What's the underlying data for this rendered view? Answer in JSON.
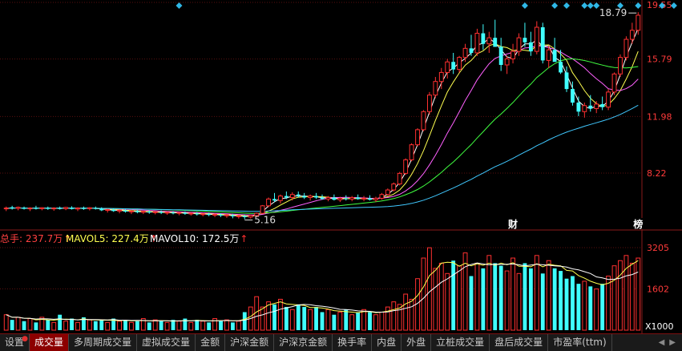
{
  "chart_data": [
    {
      "type": "candlestick",
      "price_axis": {
        "ticks": [
          "19.55",
          "15.79",
          "11.98",
          "8.22"
        ]
      },
      "annotations": {
        "high_label": "18.79",
        "low_label": "5.16",
        "markers": [
          "财",
          "榜"
        ]
      },
      "moving_averages": [
        {
          "color": "#ffffff"
        },
        {
          "color": "#ffff50"
        },
        {
          "color": "#ff60ff"
        },
        {
          "color": "#40ff40"
        },
        {
          "color": "#40c8ff"
        }
      ],
      "colors": {
        "up": "#ff3030",
        "down": "#40ffff",
        "diamond": "#2fb7e6"
      },
      "candles": [
        [
          5.9,
          6.0,
          5.7,
          5.9
        ],
        [
          5.95,
          6.05,
          5.8,
          5.88
        ],
        [
          5.88,
          6.0,
          5.75,
          5.95
        ],
        [
          5.92,
          6.0,
          5.8,
          5.85
        ],
        [
          5.85,
          5.95,
          5.7,
          5.9
        ],
        [
          5.9,
          6.05,
          5.8,
          5.88
        ],
        [
          5.86,
          5.95,
          5.75,
          5.92
        ],
        [
          5.9,
          6.0,
          5.78,
          5.85
        ],
        [
          5.85,
          5.95,
          5.72,
          5.9
        ],
        [
          5.9,
          6.0,
          5.8,
          5.86
        ],
        [
          5.86,
          5.98,
          5.76,
          5.94
        ],
        [
          5.92,
          6.02,
          5.8,
          5.84
        ],
        [
          5.84,
          5.95,
          5.7,
          5.9
        ],
        [
          5.9,
          6.0,
          5.78,
          5.86
        ],
        [
          5.86,
          5.96,
          5.74,
          5.92
        ],
        [
          5.9,
          6.0,
          5.8,
          5.85
        ],
        [
          5.85,
          5.95,
          5.7,
          5.75
        ],
        [
          5.75,
          5.85,
          5.6,
          5.8
        ],
        [
          5.78,
          5.88,
          5.65,
          5.7
        ],
        [
          5.7,
          5.8,
          5.55,
          5.76
        ],
        [
          5.74,
          5.84,
          5.6,
          5.66
        ],
        [
          5.66,
          5.76,
          5.5,
          5.7
        ],
        [
          5.7,
          5.8,
          5.55,
          5.62
        ],
        [
          5.62,
          5.72,
          5.5,
          5.68
        ],
        [
          5.66,
          5.76,
          5.52,
          5.6
        ],
        [
          5.6,
          5.7,
          5.48,
          5.65
        ],
        [
          5.64,
          5.74,
          5.5,
          5.58
        ],
        [
          5.58,
          5.68,
          5.45,
          5.62
        ],
        [
          5.6,
          5.7,
          5.48,
          5.55
        ],
        [
          5.55,
          5.65,
          5.42,
          5.6
        ],
        [
          5.58,
          5.68,
          5.45,
          5.52
        ],
        [
          5.52,
          5.62,
          5.4,
          5.56
        ],
        [
          5.54,
          5.64,
          5.4,
          5.48
        ],
        [
          5.48,
          5.58,
          5.35,
          5.52
        ],
        [
          5.5,
          5.6,
          5.36,
          5.44
        ],
        [
          5.44,
          5.54,
          5.3,
          5.48
        ],
        [
          5.46,
          5.56,
          5.3,
          5.4
        ],
        [
          5.4,
          5.5,
          5.25,
          5.44
        ],
        [
          5.42,
          5.52,
          5.22,
          5.35
        ],
        [
          5.35,
          5.45,
          5.2,
          5.38
        ],
        [
          5.36,
          5.46,
          5.16,
          5.3
        ],
        [
          5.3,
          5.45,
          5.2,
          5.4
        ],
        [
          5.4,
          5.6,
          5.3,
          5.55
        ],
        [
          5.55,
          6.1,
          5.5,
          6.05
        ],
        [
          6.05,
          6.6,
          5.95,
          6.5
        ],
        [
          6.5,
          6.9,
          6.3,
          6.4
        ],
        [
          6.4,
          6.8,
          6.2,
          6.7
        ],
        [
          6.7,
          7.0,
          6.5,
          6.6
        ],
        [
          6.6,
          6.95,
          6.4,
          6.8
        ],
        [
          6.8,
          7.0,
          6.6,
          6.7
        ],
        [
          6.7,
          6.9,
          6.5,
          6.6
        ],
        [
          6.6,
          6.8,
          6.4,
          6.7
        ],
        [
          6.7,
          6.9,
          6.5,
          6.6
        ],
        [
          6.6,
          6.8,
          6.45,
          6.5
        ],
        [
          6.5,
          6.7,
          6.35,
          6.6
        ],
        [
          6.6,
          6.8,
          6.4,
          6.45
        ],
        [
          6.45,
          6.65,
          6.3,
          6.55
        ],
        [
          6.55,
          6.75,
          6.4,
          6.5
        ],
        [
          6.5,
          6.7,
          6.35,
          6.6
        ],
        [
          6.6,
          6.8,
          6.45,
          6.5
        ],
        [
          6.5,
          6.7,
          6.35,
          6.55
        ],
        [
          6.55,
          6.75,
          6.4,
          6.45
        ],
        [
          6.45,
          6.65,
          6.3,
          6.55
        ],
        [
          6.55,
          6.9,
          6.45,
          6.8
        ],
        [
          6.8,
          7.2,
          6.7,
          7.1
        ],
        [
          7.1,
          7.6,
          7.0,
          7.5
        ],
        [
          7.5,
          8.3,
          7.4,
          8.2
        ],
        [
          8.2,
          9.2,
          8.1,
          9.1
        ],
        [
          9.1,
          10.2,
          9.0,
          10.1
        ],
        [
          10.1,
          11.2,
          10.0,
          11.1
        ],
        [
          11.1,
          12.4,
          11.0,
          12.3
        ],
        [
          12.3,
          13.6,
          12.1,
          13.4
        ],
        [
          13.4,
          14.6,
          13.2,
          14.3
        ],
        [
          14.3,
          15.2,
          13.8,
          14.9
        ],
        [
          14.9,
          15.8,
          14.5,
          15.6
        ],
        [
          15.6,
          16.2,
          14.8,
          15.1
        ],
        [
          15.1,
          16.0,
          14.9,
          15.9
        ],
        [
          15.9,
          16.8,
          15.6,
          16.5
        ],
        [
          16.5,
          17.4,
          16.0,
          16.2
        ],
        [
          16.2,
          17.8,
          16.0,
          17.5
        ],
        [
          17.5,
          18.1,
          16.4,
          16.8
        ],
        [
          16.8,
          17.6,
          16.2,
          17.2
        ],
        [
          17.2,
          18.4,
          16.8,
          16.6
        ],
        [
          16.6,
          17.2,
          15.0,
          15.4
        ],
        [
          15.4,
          16.0,
          14.8,
          15.8
        ],
        [
          15.8,
          16.8,
          15.5,
          16.3
        ],
        [
          16.3,
          17.5,
          16.0,
          17.2
        ],
        [
          17.2,
          18.2,
          16.6,
          16.9
        ],
        [
          16.9,
          17.6,
          16.0,
          16.3
        ],
        [
          16.3,
          18.3,
          16.1,
          17.9
        ],
        [
          17.9,
          18.2,
          15.5,
          15.7
        ],
        [
          15.7,
          16.7,
          15.2,
          16.4
        ],
        [
          16.4,
          17.2,
          15.8,
          15.6
        ],
        [
          15.6,
          16.4,
          14.8,
          14.9
        ],
        [
          14.9,
          15.3,
          13.6,
          13.8
        ],
        [
          13.8,
          14.3,
          12.7,
          12.9
        ],
        [
          12.9,
          13.3,
          12.0,
          12.3
        ],
        [
          12.3,
          12.9,
          11.9,
          12.7
        ],
        [
          12.7,
          13.4,
          12.3,
          12.5
        ],
        [
          12.5,
          13.0,
          12.2,
          12.8
        ],
        [
          12.8,
          13.3,
          12.4,
          12.6
        ],
        [
          12.6,
          13.8,
          12.4,
          13.6
        ],
        [
          13.6,
          14.9,
          13.4,
          14.8
        ],
        [
          14.8,
          16.1,
          14.6,
          15.9
        ],
        [
          15.9,
          17.3,
          15.7,
          17.1
        ],
        [
          17.1,
          18.2,
          16.8,
          17.7
        ],
        [
          17.7,
          18.9,
          17.4,
          18.7
        ]
      ],
      "diamond_days": [
        29,
        87,
        92,
        94,
        97,
        98,
        99,
        103,
        106,
        110,
        112,
        118
      ],
      "volume": {
        "legend": {
          "total_label": "总手: 237.7万",
          "ma5_label": "MAVOL5: 227.4万",
          "ma10_label": "MAVOL10: 172.5万"
        },
        "axis": {
          "ticks": [
            "3205",
            "1602"
          ],
          "unit": "X1000"
        },
        "colors": {
          "total": "#ff4040",
          "ma5": "#ffff50",
          "ma10": "#ffffff"
        },
        "values": [
          600,
          400,
          500,
          350,
          450,
          300,
          500,
          400,
          300,
          600,
          350,
          450,
          300,
          500,
          400,
          350,
          400,
          300,
          450,
          350,
          400,
          300,
          350,
          450,
          300,
          400,
          350,
          300,
          400,
          350,
          450,
          300,
          400,
          350,
          300,
          450,
          350,
          400,
          300,
          350,
          700,
          900,
          1300,
          900,
          1100,
          1000,
          1200,
          900,
          800,
          1000,
          900,
          800,
          900,
          700,
          800,
          600,
          700,
          800,
          600,
          700,
          800,
          700,
          600,
          700,
          900,
          1100,
          1000,
          1400,
          1200,
          2000,
          2800,
          3200,
          2400,
          2600,
          2200,
          2700,
          2500,
          3000,
          2100,
          2600,
          2400,
          2900,
          2600,
          2500,
          2300,
          2800,
          2200,
          2600,
          2400,
          2900,
          2200,
          2700,
          2400,
          2300,
          2000,
          2100,
          1800,
          1900,
          1700,
          1600,
          1800,
          2100,
          2500,
          2700,
          2900,
          2600,
          2800
        ]
      }
    }
  ],
  "toolbar": {
    "settings": "设置",
    "tabs": [
      "成交量",
      "多周期成交量",
      "虚拟成交量",
      "金额",
      "沪深金额",
      "沪深京金额",
      "换手率",
      "内盘",
      "外盘",
      "立桩成交量",
      "盘后成交量",
      "市盈率(ttm)"
    ],
    "active_index": 0
  }
}
